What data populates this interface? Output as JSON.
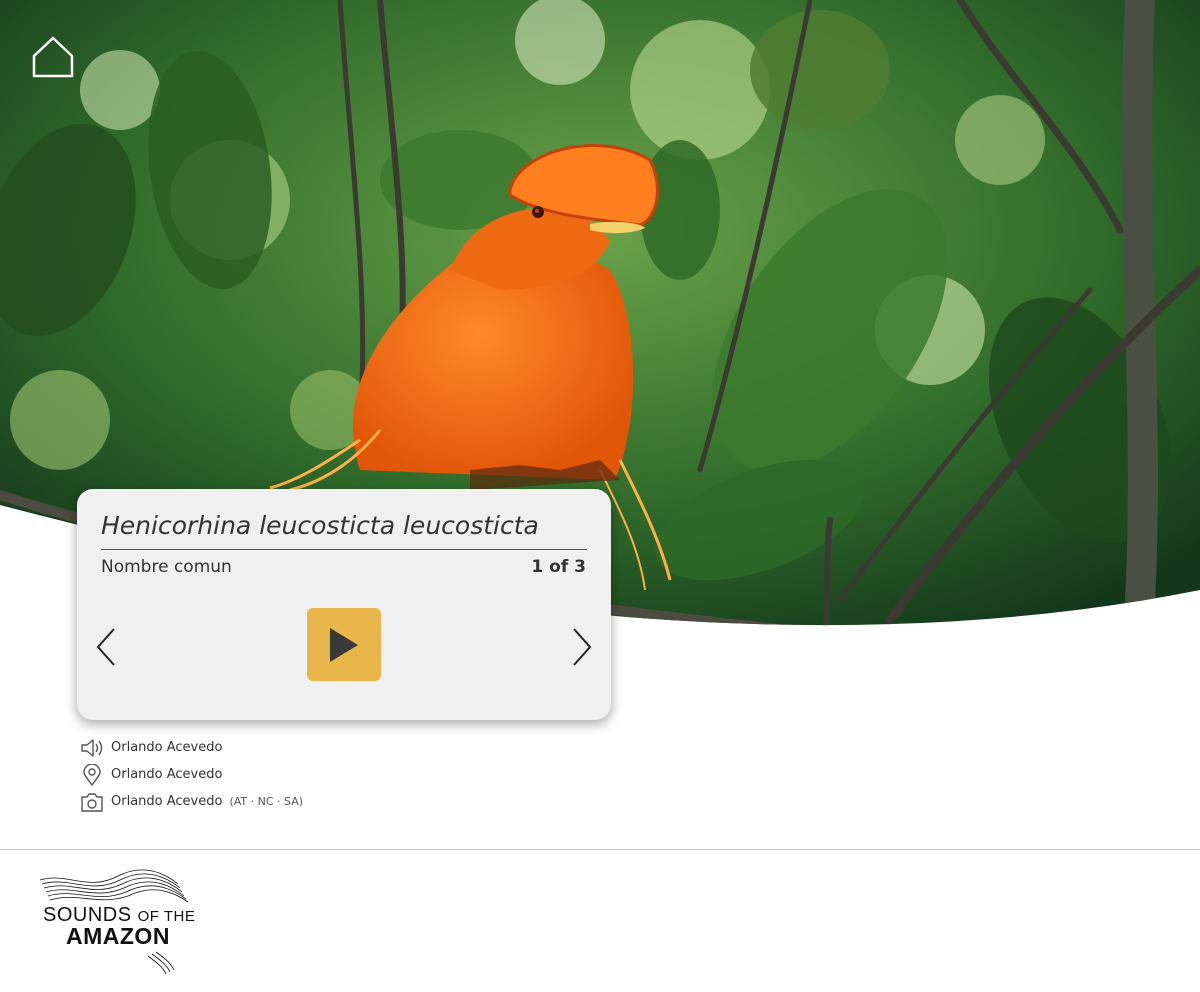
{
  "species": {
    "scientific_name": "Henicorhina leucosticta leucosticta",
    "common_name": "Nombre comun",
    "counter": "1 of 3"
  },
  "credits": [
    {
      "icon": "speaker-icon",
      "name": "Orlando Acevedo",
      "license": ""
    },
    {
      "icon": "location-pin-icon",
      "name": "Orlando Acevedo",
      "license": ""
    },
    {
      "icon": "camera-icon",
      "name": "Orlando Acevedo",
      "license": "(AT · NC · SA)"
    }
  ],
  "logo": {
    "line1": "SOUNDS",
    "line1_small": "OF THE",
    "line2": "AMAZON"
  },
  "colors": {
    "play_button": "#e8b64a",
    "card_background": "#f0f0f0",
    "footer_line": "#e3c46a",
    "bird": "#f26a10"
  }
}
